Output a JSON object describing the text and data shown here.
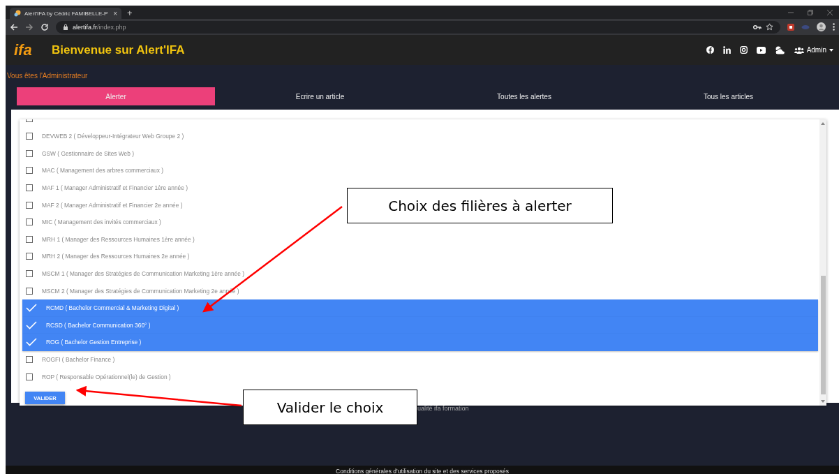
{
  "browser": {
    "tab_title": "Alert'IFA by Cédric FAMIBELLE-P",
    "tab_close": "×",
    "new_tab": "+",
    "url_host": "alertifa.fr",
    "url_path": "/index.php"
  },
  "header": {
    "logo": "ifa",
    "title": "Bienvenue sur Alert'IFA",
    "user": "Admin"
  },
  "role_text": "Vous êtes l'Administrateur",
  "tabs": [
    {
      "label": "Alerter",
      "selected": true
    },
    {
      "label": "Ecrire un article",
      "selected": false
    },
    {
      "label": "Toutes les alertes",
      "selected": false
    },
    {
      "label": "Tous les articles",
      "selected": false
    }
  ],
  "options": [
    {
      "label": "DEVWEB 2 ( Développeur-Intégrateur Web Groupe 2 )",
      "checked": false
    },
    {
      "label": "GSW ( Gestionnaire de Sites Web )",
      "checked": false
    },
    {
      "label": "MAC ( Management des arbres commerciaux )",
      "checked": false
    },
    {
      "label": "MAF 1 ( Manager Administratif et Financier 1ère année )",
      "checked": false
    },
    {
      "label": "MAF 2 ( Manager Administratif et Financier 2e année )",
      "checked": false
    },
    {
      "label": "MIC ( Management des invités commerciaux )",
      "checked": false
    },
    {
      "label": "MRH 1 ( Manager des Ressources Humaines 1ère année )",
      "checked": false
    },
    {
      "label": "MRH 2 ( Manager des Ressources Humaines 2e année )",
      "checked": false
    },
    {
      "label": "MSCM 1 ( Manager des Stratégies de Communication Marketing 1ère année )",
      "checked": false
    },
    {
      "label": "MSCM 2 ( Manager des Stratégies de Communication Marketing 2e année )",
      "checked": false
    },
    {
      "label": "RCMD ( Bachelor Commercial & Marketing Digital )",
      "checked": true
    },
    {
      "label": "RCSD ( Bachelor Communication 360° )",
      "checked": true
    },
    {
      "label": "ROG ( Bachelor Gestion Entreprise )",
      "checked": true
    },
    {
      "label": "ROGFI ( Bachelor Finance )",
      "checked": false
    },
    {
      "label": "ROP ( Responsable Opérationnel(le) de Gestion )",
      "checked": false
    }
  ],
  "submit_button": "VALIDER",
  "background_text": "ualité ifa formation",
  "footer": "Conditions générales d'utilisation du site et des services proposés",
  "callouts": [
    {
      "text": "Choix des filières à alerter"
    },
    {
      "text": "Valider le choix"
    }
  ]
}
